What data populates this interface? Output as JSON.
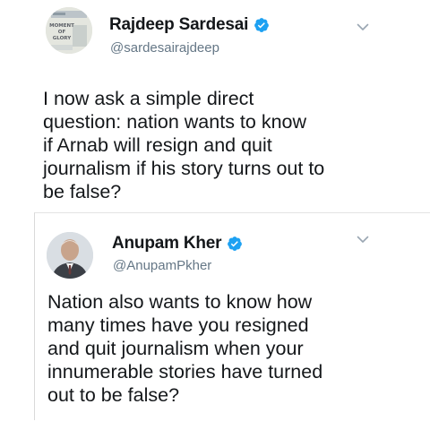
{
  "tweets": [
    {
      "name": "Rajdeep Sardesai",
      "handle": "@sardesairajdeep",
      "text": "I now ask a simple direct\nquestion: nation wants to know\nif Arnab will resign and quit\njournalism if his story turns out to\nbe false?",
      "avatar_text": "MOMENT\nOF\nGLORY",
      "verified": true,
      "avatar_icon": "book-cover-avatar",
      "menu_icon": "chevron-down-icon"
    },
    {
      "name": "Anupam Kher",
      "handle": "@AnupamPkher",
      "text": "Nation also wants to know how\nmany times have you resigned\nand quit journalism when your\ninnumerable stories have turned\nout to be false?",
      "verified": true,
      "avatar_icon": "portrait-avatar",
      "menu_icon": "chevron-down-icon"
    }
  ],
  "colors": {
    "verified_blue": "#1da1f2",
    "text": "#14171a",
    "secondary": "#657786",
    "chevron": "#9aa6b2"
  }
}
